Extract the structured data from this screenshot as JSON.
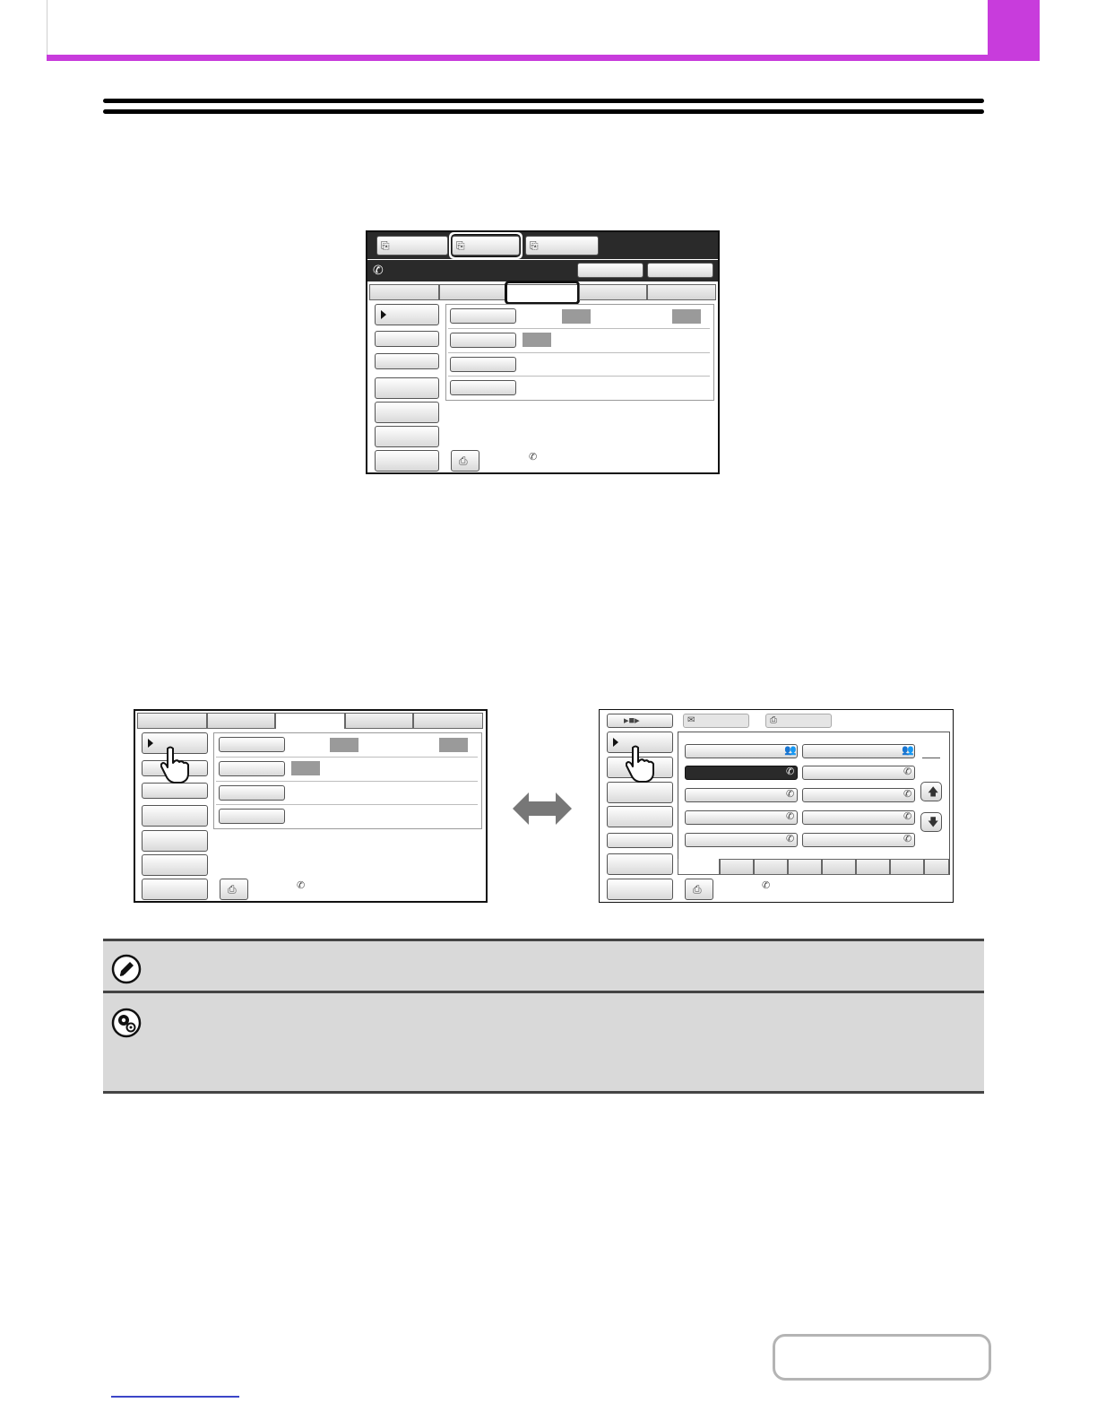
{
  "theme": {
    "accent": "#c83cdc",
    "panel_dark": "#2a2a2a",
    "note_bg": "#d9d9d9",
    "link": "#3c46c8"
  },
  "icons": {
    "fax_line": "phone-handset-icon",
    "pointer": "hand-pointer-icon",
    "swap": "double-arrow-icon",
    "note": "pencil-note-icon",
    "settings": "gear-settings-icon",
    "up": "arrow-up-icon",
    "down": "arrow-down-icon"
  }
}
